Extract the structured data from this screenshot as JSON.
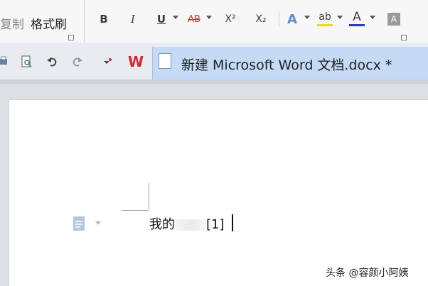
{
  "ribbon": {
    "copy_label": "复制",
    "format_painter_label": "格式刷",
    "bold_label": "B",
    "italic_label": "I",
    "underline_label": "U",
    "strikethrough_label": "AB",
    "superscript_label": "X²",
    "subscript_label": "X₂",
    "text_effect_label": "A",
    "highlight_label": "ab",
    "font_color_label": "A",
    "char_shading_label": "A"
  },
  "toolbar": {
    "wps_logo": "W",
    "icons": [
      "print-icon",
      "print-preview-icon",
      "undo-icon",
      "redo-icon",
      "format-marker-icon"
    ]
  },
  "tab": {
    "title": "新建 Microsoft Word 文档.docx *"
  },
  "document": {
    "text_prefix": "我的",
    "text_suffix": "[1]"
  },
  "watermark": {
    "text": "头条 @容颜小阿姨"
  },
  "colors": {
    "tab_active": "#c5daf5",
    "font_color_underline": "#1f3fd0",
    "highlight_yellow": "#f0e000",
    "wps_red": "#d7262d",
    "strike_red": "#c0392b"
  }
}
